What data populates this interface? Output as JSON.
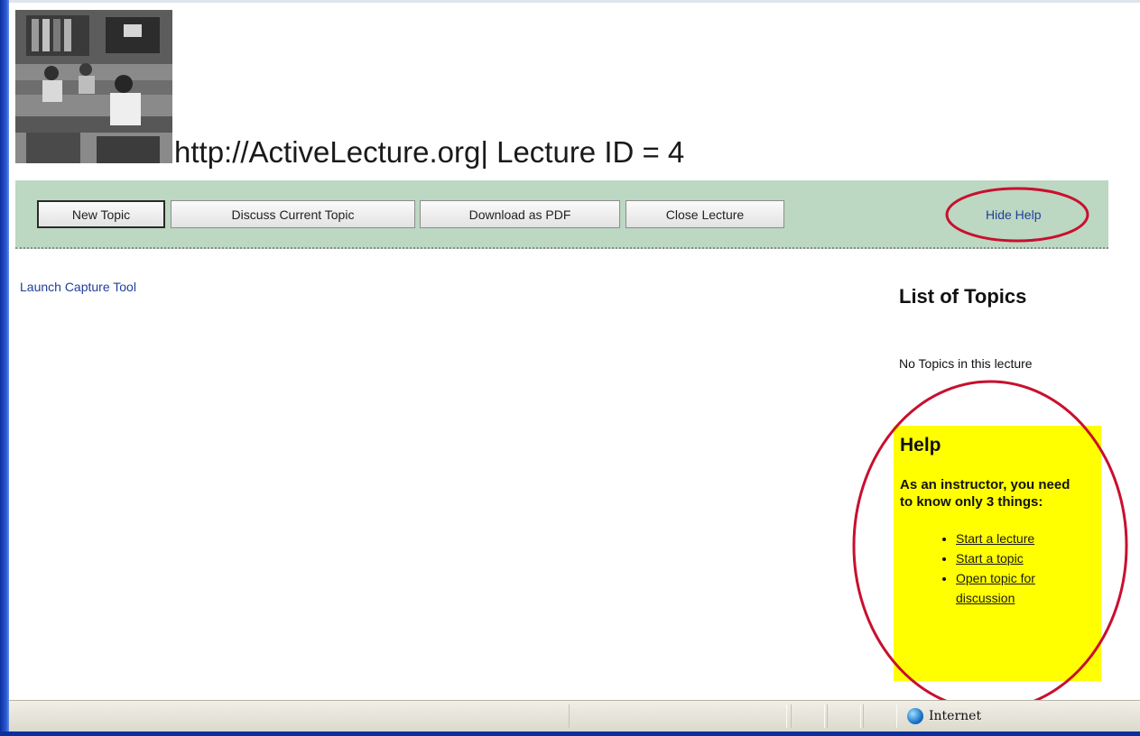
{
  "header": {
    "title": "http://ActiveLecture.org| Lecture ID = 4"
  },
  "toolbar": {
    "buttons": [
      "New Topic",
      "Discuss Current Topic",
      "Download as PDF",
      "Close Lecture"
    ],
    "hide_help": "Hide Help"
  },
  "main": {
    "launch_link": "Launch Capture Tool"
  },
  "sidebar": {
    "heading": "List of Topics",
    "empty_message": "No Topics in this lecture"
  },
  "help": {
    "heading": "Help",
    "intro": "As an instructor, you need to know only 3 things:",
    "links": [
      "Start a lecture",
      "Start a topic",
      "Open topic for discussion"
    ]
  },
  "statusbar": {
    "zone": "Internet"
  },
  "colors": {
    "toolbar_bg": "#bcd7c2",
    "help_bg": "#ffff00",
    "annotation": "#c8102e",
    "link": "#1f3f9a"
  }
}
